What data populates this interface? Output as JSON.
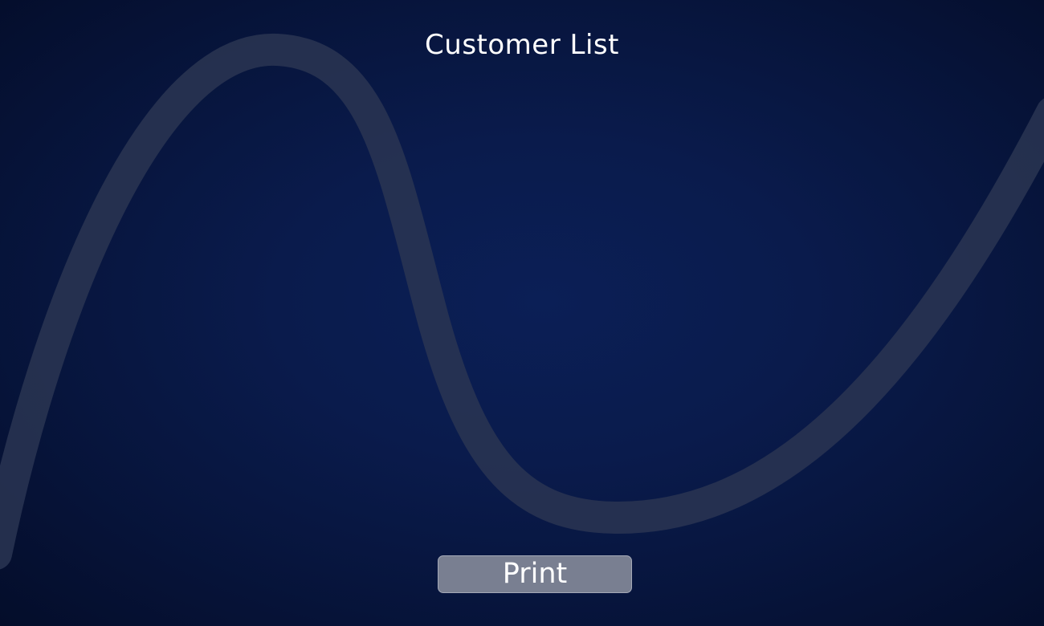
{
  "page": {
    "title": "Customer List"
  },
  "actions": {
    "print_label": "Print"
  },
  "colors": {
    "background": "#0a1b4c",
    "swoosh": "#2a3552",
    "button": "#797f91",
    "text": "#ffffff"
  }
}
